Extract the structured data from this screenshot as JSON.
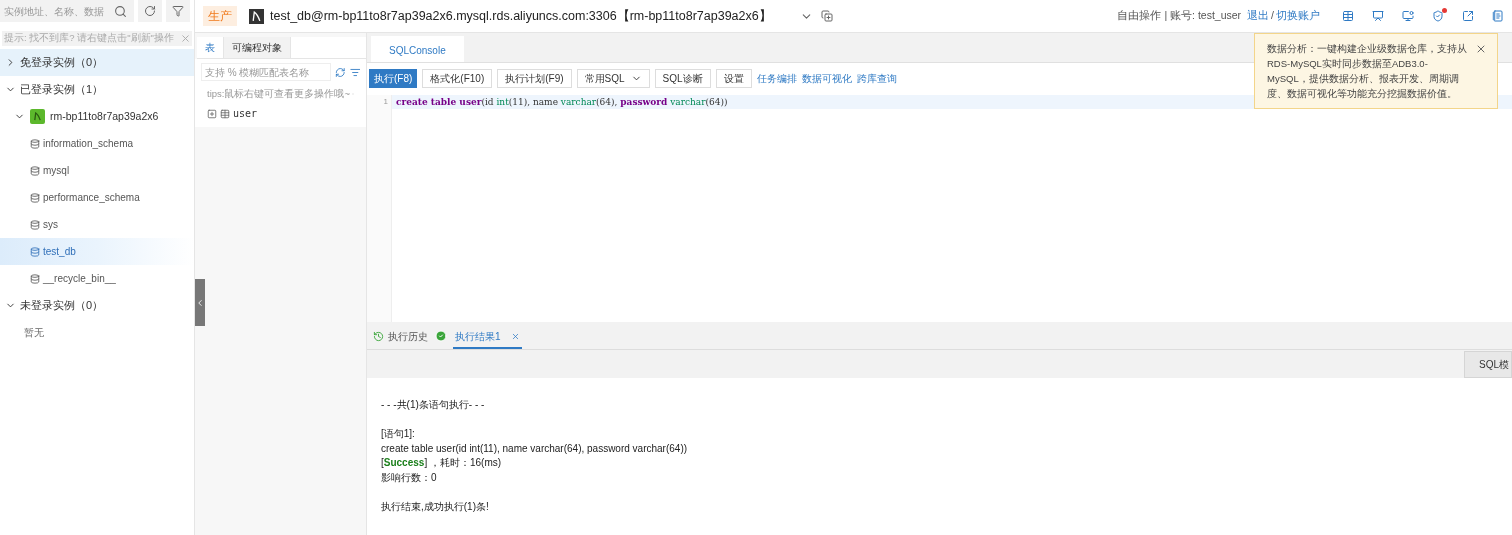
{
  "sidebar": {
    "search": {
      "placeholder": "实例地址、名称、数据"
    },
    "hint": "提示: 找不到库? 请右键点击\"刷新\"操作",
    "sections": [
      {
        "label": "免登录实例（0）",
        "expanded": false,
        "selected": true
      },
      {
        "label": "已登录实例（1）",
        "expanded": true,
        "selected": false,
        "children": [
          {
            "label": "rm-bp11to8r7ap39a2x6",
            "expanded": true,
            "children": [
              {
                "label": "information_schema",
                "selected": false
              },
              {
                "label": "mysql",
                "selected": false
              },
              {
                "label": "performance_schema",
                "selected": false
              },
              {
                "label": "sys",
                "selected": false
              },
              {
                "label": "test_db",
                "selected": true
              },
              {
                "label": "__recycle_bin__",
                "selected": false
              }
            ]
          }
        ]
      },
      {
        "label": "未登录实例（0）",
        "expanded": true,
        "selected": false,
        "empty": "暂无"
      }
    ]
  },
  "header": {
    "env": "生产",
    "title": "test_db@rm-bp11to8r7ap39a2x6.mysql.rds.aliyuncs.com:3306【rm-bp11to8r7ap39a2x6】",
    "mode": "自由操作 | 账号: test_user",
    "logout": "退出",
    "separator": "/",
    "switch": "切换账户",
    "icons": [
      {
        "kind": "table",
        "badge": false
      },
      {
        "kind": "screen",
        "badge": false
      },
      {
        "kind": "monitor",
        "badge": false
      },
      {
        "kind": "shield",
        "badge": true
      },
      {
        "kind": "external",
        "badge": false
      },
      {
        "kind": "list",
        "badge": false
      }
    ]
  },
  "tooltip": "数据分析：一键构建企业级数据仓库，支持从RDS-MySQL实时同步数据至ADB3.0-MySQL，提供数据分析、报表开发、周期调度、数据可视化等功能充分挖掘数据价值。",
  "objects": {
    "tabs": [
      {
        "label": "表",
        "selected": true
      },
      {
        "label": "可编程对象",
        "selected": false
      }
    ],
    "search": {
      "placeholder": "支持 % 模糊匹配表名称"
    },
    "tips": "tips:鼠标右键可查看更多操作哦~",
    "tables": [
      "user"
    ]
  },
  "console": {
    "tab": "SQLConsole",
    "toolbar": [
      {
        "label": "执行(F8)",
        "kind": "primary"
      },
      {
        "label": "格式化(F10)",
        "kind": "button"
      },
      {
        "label": "执行计划(F9)",
        "kind": "button"
      },
      {
        "label": "常用SQL",
        "kind": "dropdown"
      },
      {
        "label": "SQL诊断",
        "kind": "button"
      },
      {
        "label": "设置",
        "kind": "button"
      },
      {
        "label": "任务编排",
        "kind": "link"
      },
      {
        "label": "数据可视化",
        "kind": "link"
      },
      {
        "label": "跨库查询",
        "kind": "link"
      }
    ],
    "lines": [
      {
        "number": "1",
        "tokens": [
          {
            "text": "create table user",
            "kind": "keyword"
          },
          {
            "text": "(id ",
            "kind": "plain"
          },
          {
            "text": "int",
            "kind": "type"
          },
          {
            "text": "(11), name ",
            "kind": "plain"
          },
          {
            "text": "varchar",
            "kind": "type"
          },
          {
            "text": "(64), ",
            "kind": "plain"
          },
          {
            "text": "password",
            "kind": "keyword"
          },
          {
            "text": " varchar",
            "kind": "type"
          },
          {
            "text": "(64))",
            "kind": "plain"
          }
        ]
      }
    ]
  },
  "results": {
    "tabs": [
      {
        "label": "执行历史",
        "kind": "history",
        "selected": false
      },
      {
        "label": "执行结果1",
        "kind": "result",
        "selected": true
      }
    ],
    "template_button": "SQL模",
    "log": [
      [
        "- - -共(1)条语句执行- - -"
      ],
      [
        "[语句1]:",
        "create table user(id int(11), name varchar(64), password varchar(64))",
        "[**Success**] ，耗时：16(ms)",
        "影响行数：0"
      ],
      [
        "执行结束,成功执行(1)条!"
      ]
    ]
  }
}
